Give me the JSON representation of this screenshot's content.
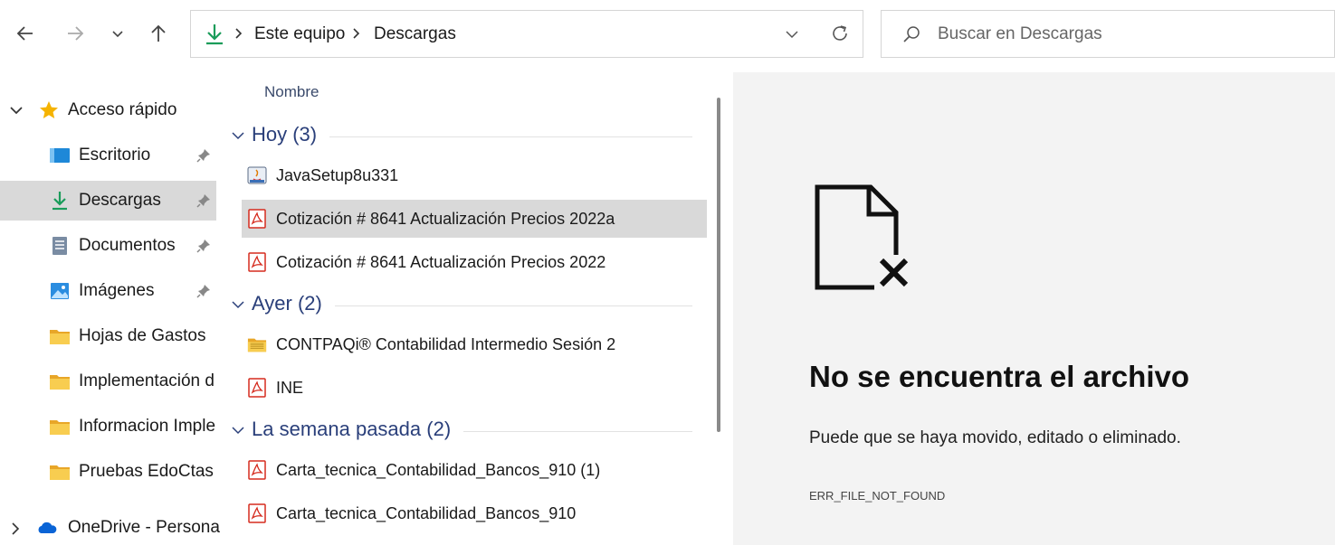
{
  "toolbar": {
    "back": "back-arrow",
    "forward": "forward-arrow",
    "recent": "chevron-down",
    "up": "up-arrow"
  },
  "address": {
    "icon": "download-icon",
    "crumbs": [
      "Este equipo",
      "Descargas"
    ]
  },
  "search": {
    "placeholder": "Buscar en Descargas"
  },
  "sidebar": {
    "quick_access": "Acceso rápido",
    "items": [
      {
        "label": "Escritorio",
        "icon": "desktop-icon",
        "pinned": true
      },
      {
        "label": "Descargas",
        "icon": "download-icon",
        "pinned": true,
        "selected": true
      },
      {
        "label": "Documentos",
        "icon": "documents-icon",
        "pinned": true
      },
      {
        "label": "Imágenes",
        "icon": "pictures-icon",
        "pinned": true
      },
      {
        "label": "Hojas de Gastos",
        "icon": "folder-icon"
      },
      {
        "label": "Implementación d",
        "icon": "folder-icon"
      },
      {
        "label": "Informacion Imple",
        "icon": "folder-icon"
      },
      {
        "label": "Pruebas EdoCtas",
        "icon": "folder-icon"
      }
    ],
    "onedrive": "OneDrive - Personal"
  },
  "filelist": {
    "column": "Nombre",
    "groups": [
      {
        "label": "Hoy (3)",
        "files": [
          "JavaSetup8u331",
          "Cotización # 8641 Actualización Precios 2022a",
          "Cotización # 8641 Actualización Precios 2022"
        ]
      },
      {
        "label": "Ayer (2)",
        "files": [
          "CONTPAQi® Contabilidad Intermedio Sesión 2",
          "INE"
        ]
      },
      {
        "label": "La semana pasada (2)",
        "files": [
          "Carta_tecnica_Contabilidad_Bancos_910 (1)",
          "Carta_tecnica_Contabilidad_Bancos_910"
        ]
      }
    ]
  },
  "preview": {
    "title": "No se encuentra el archivo",
    "message": "Puede que se haya movido, editado o eliminado.",
    "code": "ERR_FILE_NOT_FOUND"
  },
  "colors": {
    "accent": "#2a3f7a",
    "download": "#1a9c5a",
    "pdf": "#d52b1e",
    "folder": "#f4c542",
    "selection": "#d9d9d9"
  }
}
